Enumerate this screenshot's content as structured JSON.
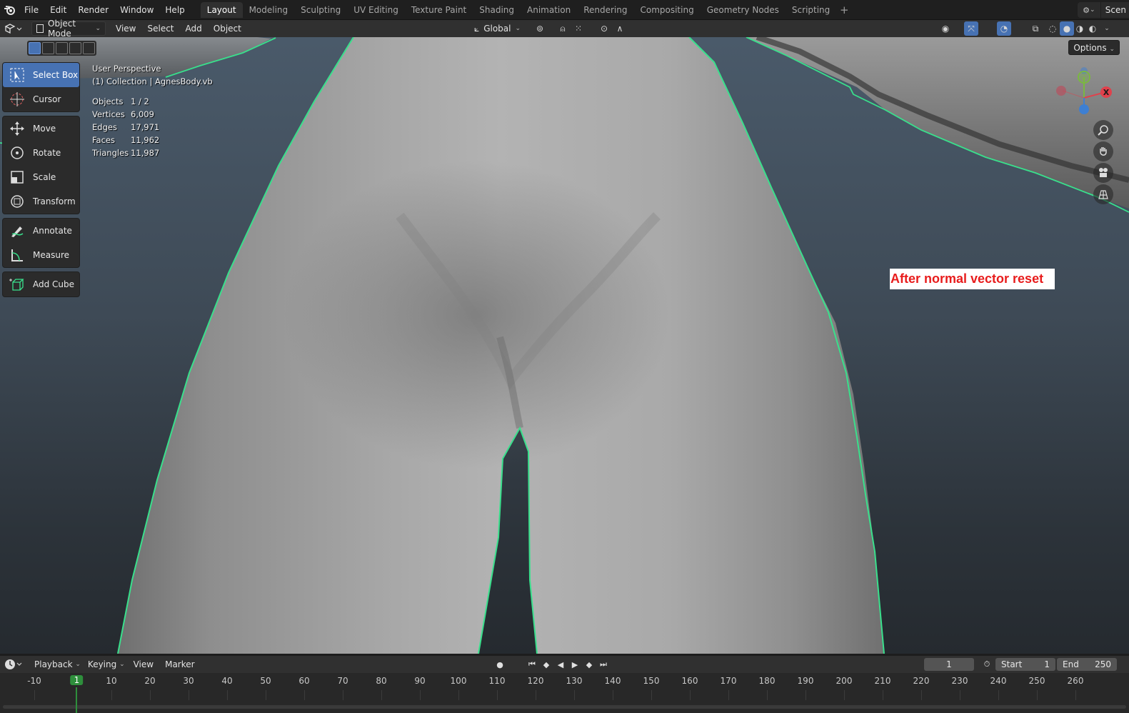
{
  "topbar": {
    "menus": [
      "File",
      "Edit",
      "Render",
      "Window",
      "Help"
    ],
    "workspaces": [
      "Layout",
      "Modeling",
      "Sculpting",
      "UV Editing",
      "Texture Paint",
      "Shading",
      "Animation",
      "Rendering",
      "Compositing",
      "Geometry Nodes",
      "Scripting"
    ],
    "active_workspace": "Layout",
    "scene_label": "Scen"
  },
  "header": {
    "mode": "Object Mode",
    "menus": [
      "View",
      "Select",
      "Add",
      "Object"
    ],
    "orientation": "Global"
  },
  "viewport": {
    "perspective": "User Perspective",
    "collection": "(1) Collection | AgnesBody.vb",
    "stats": [
      {
        "label": "Objects",
        "value": "1 / 2"
      },
      {
        "label": "Vertices",
        "value": "6,009"
      },
      {
        "label": "Edges",
        "value": "17,971"
      },
      {
        "label": "Faces",
        "value": "11,962"
      },
      {
        "label": "Triangles",
        "value": "11,987"
      }
    ],
    "options_label": "Options",
    "annotation": "After normal vector reset",
    "selection_outline_color": "#39e08c",
    "gizmo": {
      "x_label": "X",
      "x_color": "#e0414c",
      "y_color": "#7ab840",
      "z_color": "#3e7fd2"
    }
  },
  "toolbar": {
    "groups": [
      [
        {
          "label": "Select Box",
          "icon": "select-box-icon",
          "active": true
        },
        {
          "label": "Cursor",
          "icon": "cursor-icon",
          "active": false
        }
      ],
      [
        {
          "label": "Move",
          "icon": "move-icon",
          "active": false
        },
        {
          "label": "Rotate",
          "icon": "rotate-icon",
          "active": false
        },
        {
          "label": "Scale",
          "icon": "scale-icon",
          "active": false
        },
        {
          "label": "Transform",
          "icon": "transform-icon",
          "active": false
        }
      ],
      [
        {
          "label": "Annotate",
          "icon": "annotate-icon",
          "active": false
        },
        {
          "label": "Measure",
          "icon": "measure-icon",
          "active": false
        }
      ],
      [
        {
          "label": "Add Cube",
          "icon": "add-cube-icon",
          "active": false
        }
      ]
    ]
  },
  "timeline": {
    "menus": [
      "Playback",
      "Keying",
      "View",
      "Marker"
    ],
    "current_frame": "1",
    "start_label": "Start",
    "start": "1",
    "end_label": "End",
    "end": "250",
    "ruler": [
      "-10",
      "1",
      "10",
      "20",
      "30",
      "40",
      "50",
      "60",
      "70",
      "80",
      "90",
      "100",
      "110",
      "120",
      "130",
      "140",
      "150",
      "160",
      "170",
      "180",
      "190",
      "200",
      "210",
      "220",
      "230",
      "240",
      "250",
      "260"
    ],
    "current_color": "#2e8f3c"
  }
}
